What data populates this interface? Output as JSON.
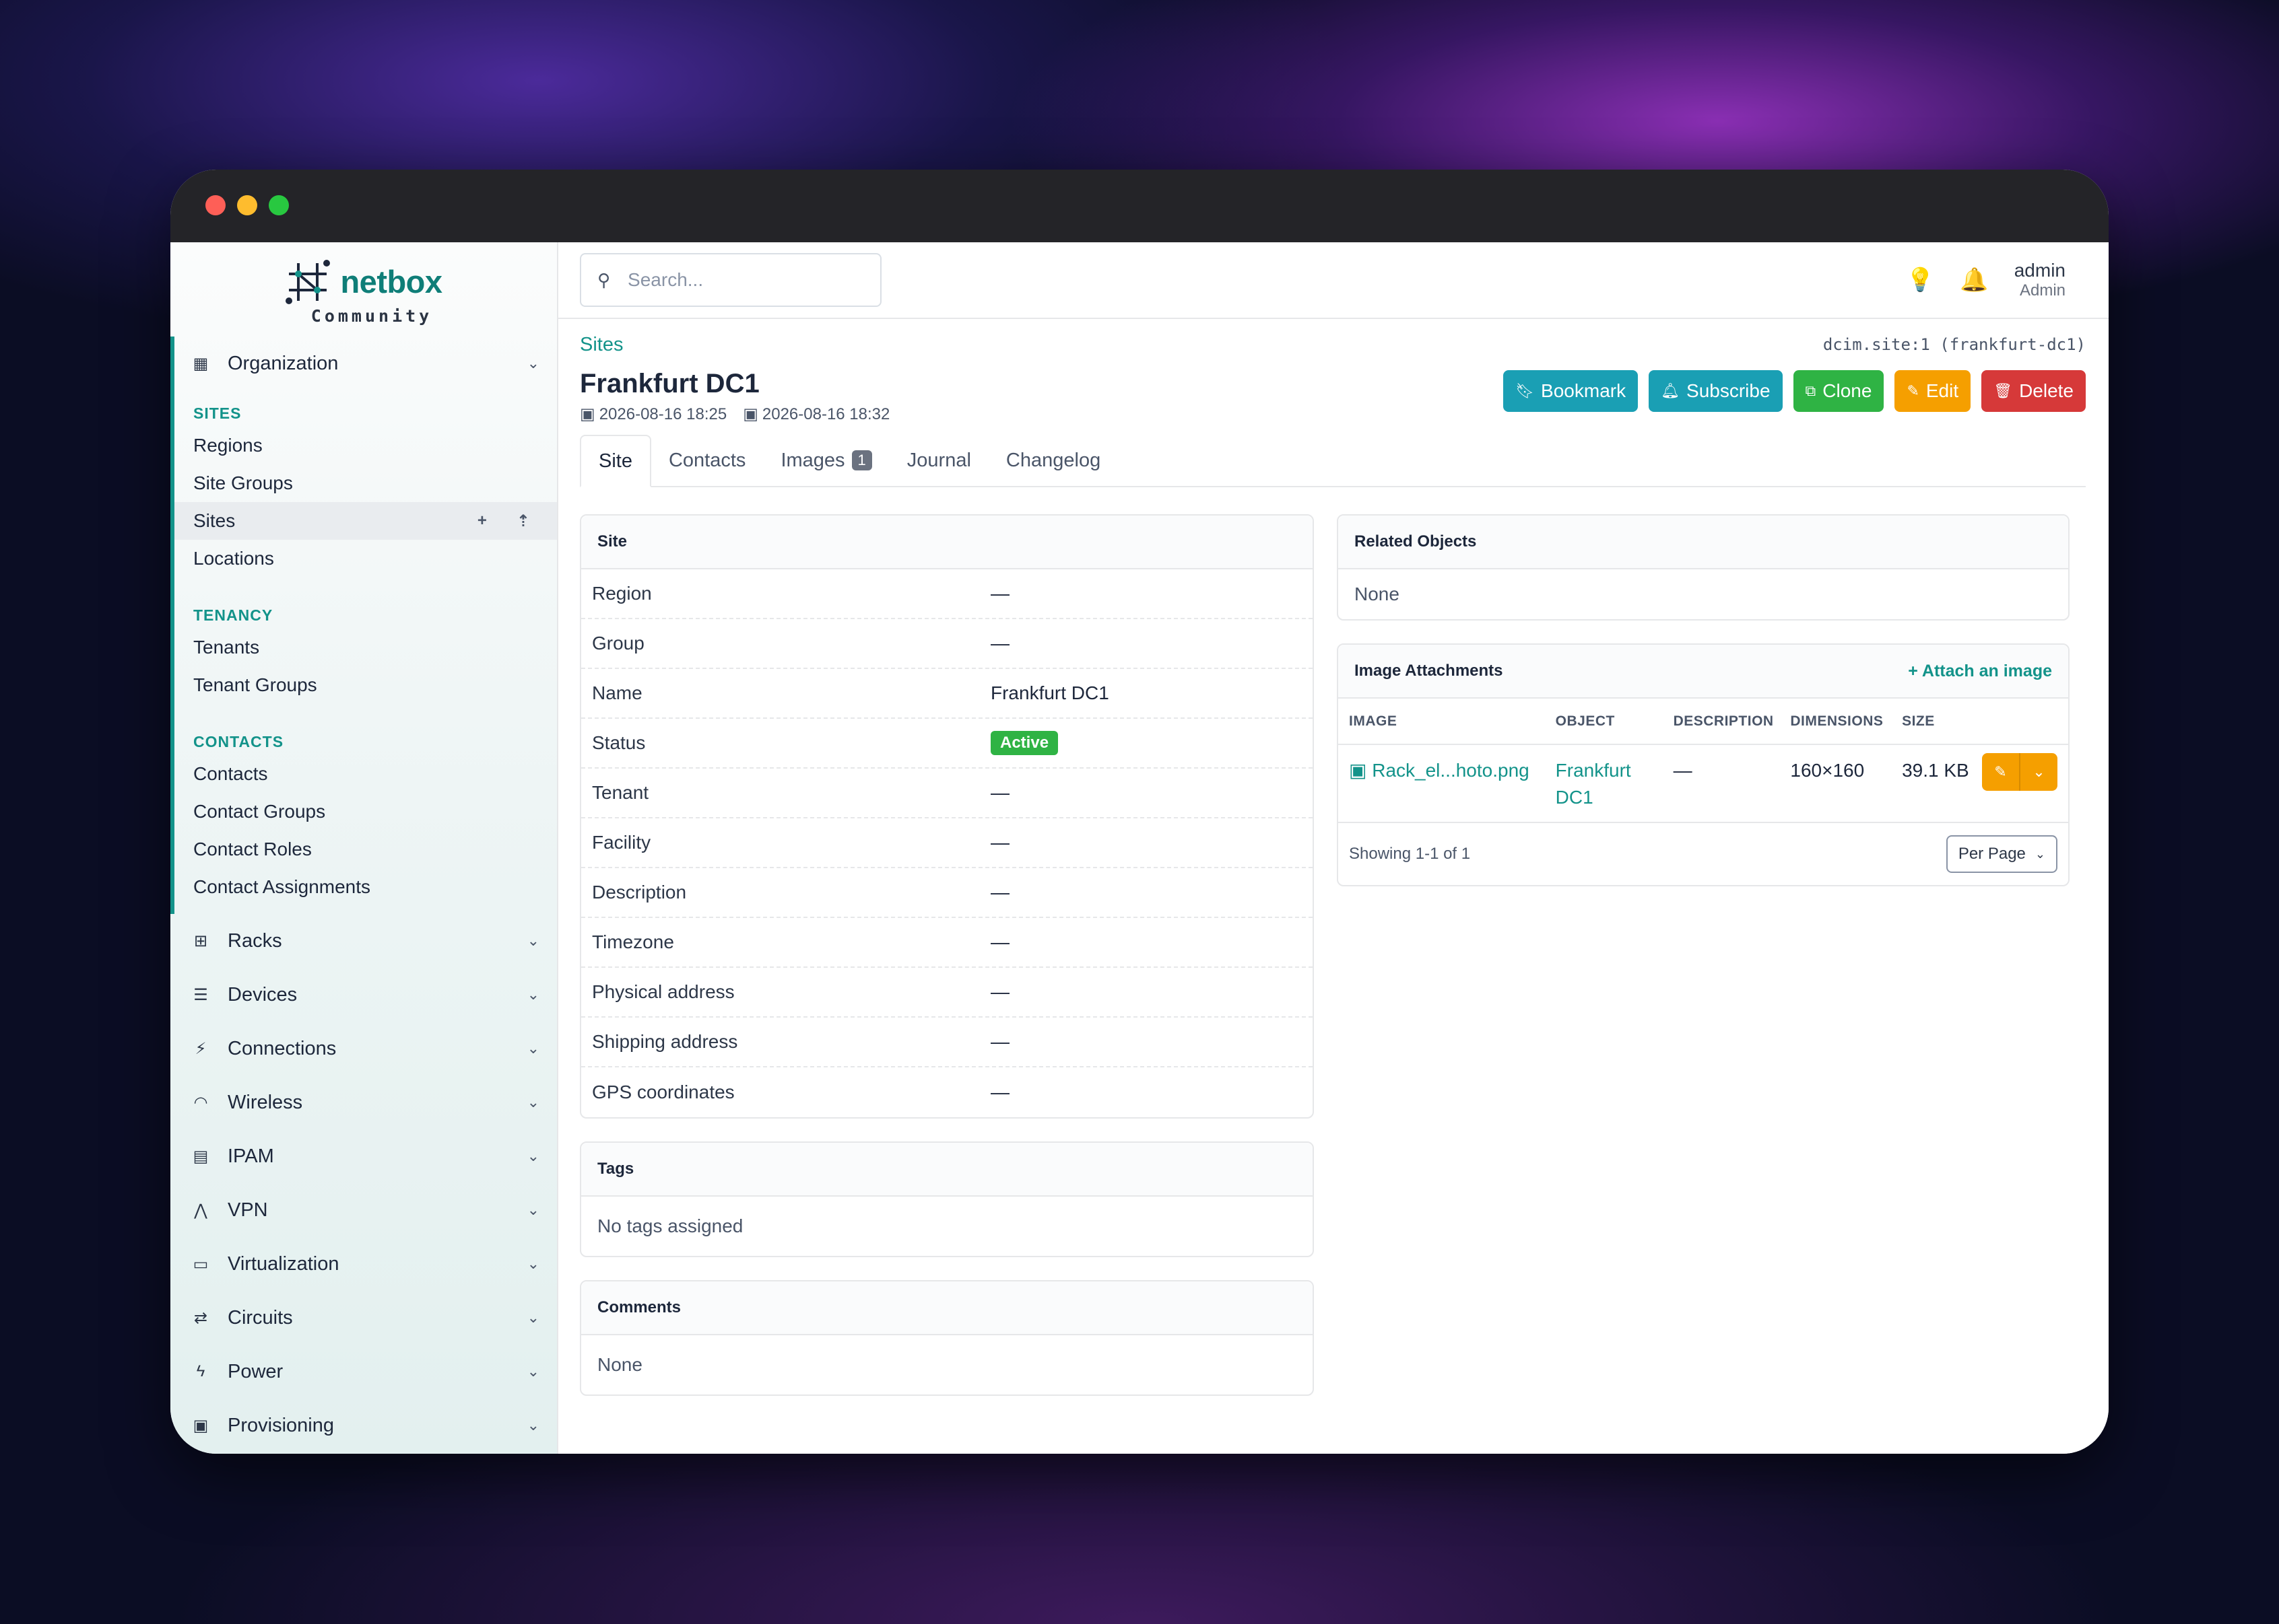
{
  "sidebar": {
    "logo_text": "netbox",
    "logo_sub": "Community",
    "organization": "Organization",
    "sections": [
      {
        "title": "SITES",
        "items": [
          "Regions",
          "Site Groups",
          "Sites",
          "Locations"
        ]
      },
      {
        "title": "TENANCY",
        "items": [
          "Tenants",
          "Tenant Groups"
        ]
      },
      {
        "title": "CONTACTS",
        "items": [
          "Contacts",
          "Contact Groups",
          "Contact Roles",
          "Contact Assignments"
        ]
      }
    ],
    "groups": [
      "Racks",
      "Devices",
      "Connections",
      "Wireless",
      "IPAM",
      "VPN",
      "Virtualization",
      "Circuits",
      "Power",
      "Provisioning"
    ]
  },
  "topbar": {
    "search_placeholder": "Search...",
    "user_name": "admin",
    "user_role": "Admin"
  },
  "page": {
    "breadcrumb": "Sites",
    "object_id": "dcim.site:1 (frankfurt-dc1)",
    "title": "Frankfurt DC1",
    "created": "2026-08-16 18:25",
    "updated": "2026-08-16 18:32",
    "buttons": {
      "bookmark": "Bookmark",
      "subscribe": "Subscribe",
      "clone": "Clone",
      "edit": "Edit",
      "delete": "Delete"
    },
    "tabs": [
      "Site",
      "Contacts",
      "Images",
      "Journal",
      "Changelog"
    ],
    "images_count": "1"
  },
  "site_card": {
    "title": "Site",
    "rows": [
      {
        "k": "Region",
        "v": "—"
      },
      {
        "k": "Group",
        "v": "—"
      },
      {
        "k": "Name",
        "v": "Frankfurt DC1"
      },
      {
        "k": "Status",
        "v": "Active"
      },
      {
        "k": "Tenant",
        "v": "—"
      },
      {
        "k": "Facility",
        "v": "—"
      },
      {
        "k": "Description",
        "v": "—"
      },
      {
        "k": "Timezone",
        "v": "—"
      },
      {
        "k": "Physical address",
        "v": "—"
      },
      {
        "k": "Shipping address",
        "v": "—"
      },
      {
        "k": "GPS coordinates",
        "v": "—"
      }
    ]
  },
  "tags_card": {
    "title": "Tags",
    "body": "No tags assigned"
  },
  "comments_card": {
    "title": "Comments",
    "body": "None"
  },
  "related_card": {
    "title": "Related Objects",
    "body": "None"
  },
  "images_card": {
    "title": "Image Attachments",
    "attach": "Attach an image",
    "columns": [
      "IMAGE",
      "OBJECT",
      "DESCRIPTION",
      "DIMENSIONS",
      "SIZE"
    ],
    "row": {
      "image": "Rack_el...hoto.png",
      "object_1": "Frankfurt",
      "object_2": "DC1",
      "description": "—",
      "dimensions": "160×160",
      "size": "39.1 KB"
    },
    "showing": "Showing 1-1 of 1",
    "per_page": "Per Page"
  },
  "colors": {
    "accent": "#13938a",
    "teal_btn": "#1a9fb4",
    "green": "#2fb344",
    "orange": "#f59f00",
    "red": "#d63939"
  }
}
